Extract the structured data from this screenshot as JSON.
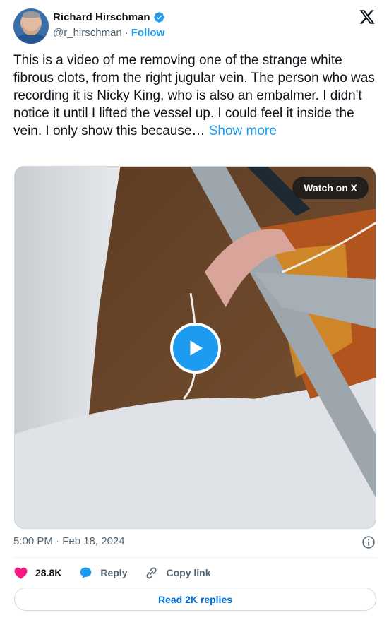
{
  "author": {
    "name": "Richard Hirschman",
    "handle": "@r_hirschman",
    "separator": "·",
    "follow_label": "Follow",
    "verified_color": "#1d9bf0"
  },
  "tweet": {
    "text": "This is a video of me removing one of the strange white fibrous clots, from the right jugular vein. The person who was recording it is Nicky King, who is also an embalmer. I  didn't notice it until I lifted the vessel up. I could feel it inside the vein. I only show this because…",
    "show_more_label": "Show more"
  },
  "media": {
    "watch_label": "Watch on X",
    "play_icon": "play-icon"
  },
  "meta": {
    "timestamp": "5:00 PM · Feb 18, 2024"
  },
  "actions": {
    "like_count": "28.8K",
    "reply_label": "Reply",
    "copy_label": "Copy link",
    "like_color": "#f91880",
    "reply_color": "#1d9bf0"
  },
  "footer": {
    "read_replies_label": "Read 2K replies"
  }
}
